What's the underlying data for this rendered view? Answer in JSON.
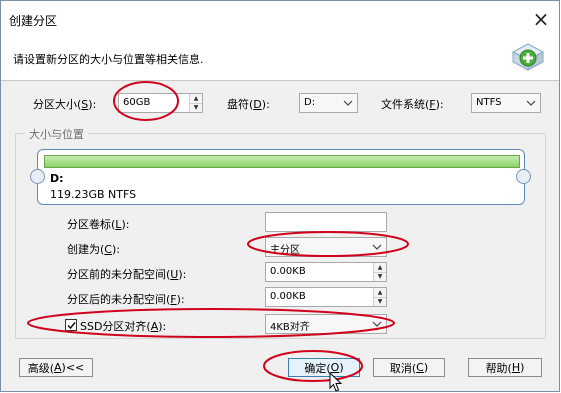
{
  "window": {
    "title": "创建分区",
    "close_glyph": "×"
  },
  "header": {
    "description": "请设置新分区的大小与位置等相关信息."
  },
  "size_row": {
    "size_label": "分区大小(",
    "size_label_key": "S",
    "size_label_tail": "):",
    "size_value": "60GB",
    "drive_label": "盘符(",
    "drive_label_key": "D",
    "drive_label_tail": "):",
    "drive_value": "D:",
    "fs_label": "文件系统(",
    "fs_label_key": "F",
    "fs_label_tail": "):",
    "fs_value": "NTFS"
  },
  "group": {
    "title": "大小与位置"
  },
  "disk": {
    "name": "D:",
    "size": "119.23GB NTFS"
  },
  "fields": {
    "volume_label": "分区卷标(",
    "volume_label_key": "L",
    "volume_label_tail": "):",
    "volume_value": "",
    "create_as_label": "创建为(",
    "create_as_key": "C",
    "create_as_tail": "):",
    "create_as_value": "主分区",
    "free_before_label": "分区前的未分配空间(",
    "free_before_key": "U",
    "free_before_tail": "):",
    "free_before_value": "0.00KB",
    "free_after_label": "分区后的未分配空间(",
    "free_after_key": "F",
    "free_after_tail": "):",
    "free_after_value": "0.00KB",
    "ssd_label": "SSD分区对齐(",
    "ssd_key": "A",
    "ssd_tail": "):",
    "ssd_checked": true,
    "ssd_value": "4KB对齐"
  },
  "buttons": {
    "advanced": "高级(",
    "advanced_key": "A",
    "advanced_tail": ")<<",
    "ok": "确定(",
    "ok_key": "O",
    "ok_tail": ")",
    "cancel": "取消(",
    "cancel_key": "C",
    "cancel_tail": ")",
    "help": "帮助(",
    "help_key": "H",
    "help_tail": ")"
  },
  "colors": {
    "annotation": "#d0021b",
    "disk_bar": "#8bd367",
    "primary_border": "#3c7fb1"
  }
}
